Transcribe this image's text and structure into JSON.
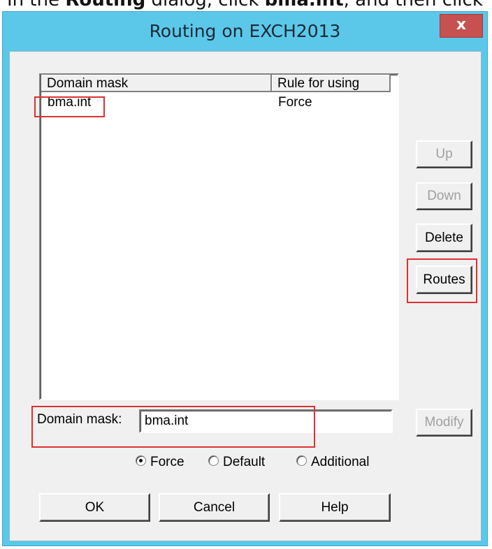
{
  "instruction": {
    "prefix": "In the ",
    "bold1": "Routing",
    "mid": " dialog, click ",
    "bold2": "bma.int",
    "suffix": ", and then click"
  },
  "window": {
    "title": "Routing on EXCH2013",
    "close_label": "x"
  },
  "list": {
    "columns": [
      "Domain mask",
      "Rule for using"
    ],
    "rows": [
      {
        "domain": "bma.int",
        "rule": "Force"
      }
    ]
  },
  "buttons": {
    "up": "Up",
    "down": "Down",
    "delete": "Delete",
    "routes": "Routes",
    "modify": "Modify",
    "ok": "OK",
    "cancel": "Cancel",
    "help": "Help"
  },
  "domain_mask": {
    "label": "Domain mask:",
    "value": "bma.int"
  },
  "rule_options": {
    "options": [
      "Force",
      "Default",
      "Additional"
    ],
    "selected": "Force"
  },
  "colors": {
    "title_bar": "#5bc8ea",
    "highlight": "#e03030",
    "close_button": "#c75050"
  }
}
